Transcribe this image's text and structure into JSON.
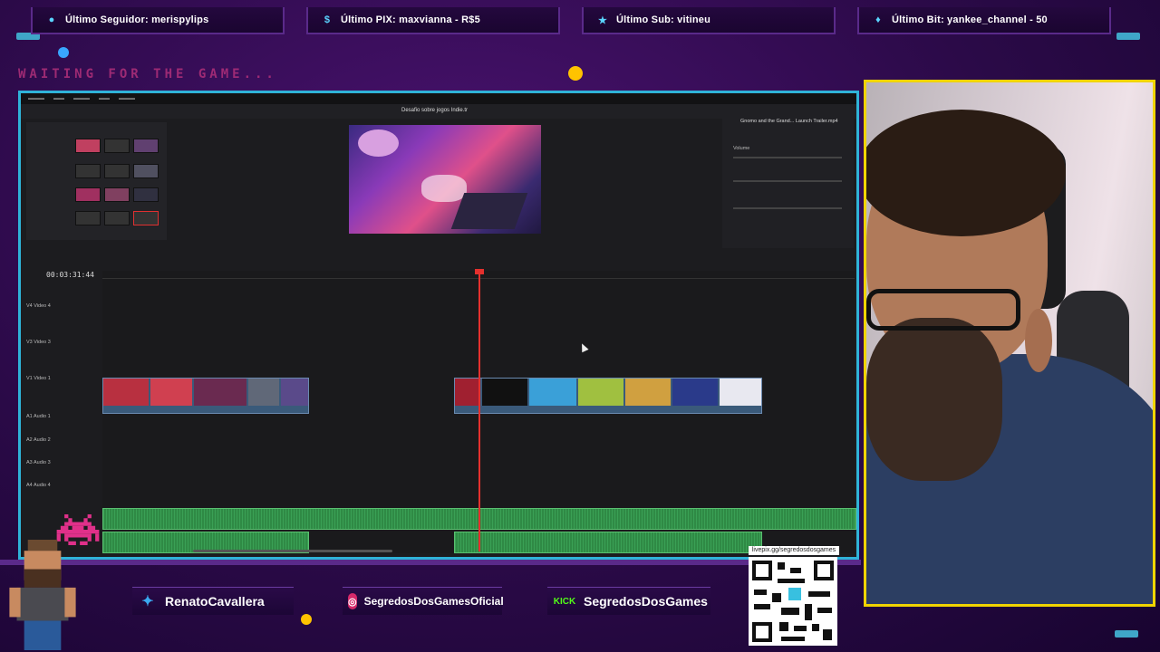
{
  "alerts": {
    "follower": "Último Seguidor: merispylips",
    "pix": "Último PIX: maxvianna - R$5",
    "sub": "Último Sub: vitineu",
    "bit": "Último Bit: yankee_channel - 50"
  },
  "overlay": {
    "waiting_text": "WAITING FOR THE GAME..."
  },
  "editor": {
    "project_title": "Desafio sobre jogos Indie.tr",
    "timecode": "00:03:31:44",
    "inspector_clip": "Gnomo and the Grand... Launch Trailer.mp4",
    "inspector_volume": "Volume",
    "tracks": [
      {
        "id": "V4",
        "label": "Video 4"
      },
      {
        "id": "V3",
        "label": "Video 3"
      },
      {
        "id": "V1",
        "label": "Video 1"
      },
      {
        "id": "A1",
        "label": "Audio 1"
      },
      {
        "id": "A2",
        "label": "Audio 2"
      },
      {
        "id": "A3",
        "label": "Audio 3"
      },
      {
        "id": "A4",
        "label": "Audio 4"
      }
    ]
  },
  "socials": {
    "twitter": "RenatoCavallera",
    "instagram": "SegredosDosGamesOficial",
    "kick_badge": "KICK",
    "kick": "SegredosDosGames",
    "livepix_url": "livepix.gg/segredosdosgames"
  },
  "colors": {
    "frame_accent": "#2fb3d8",
    "webcam_border": "#f0d400",
    "playhead": "#e5302d",
    "audio_clip": "#2f8a45"
  }
}
